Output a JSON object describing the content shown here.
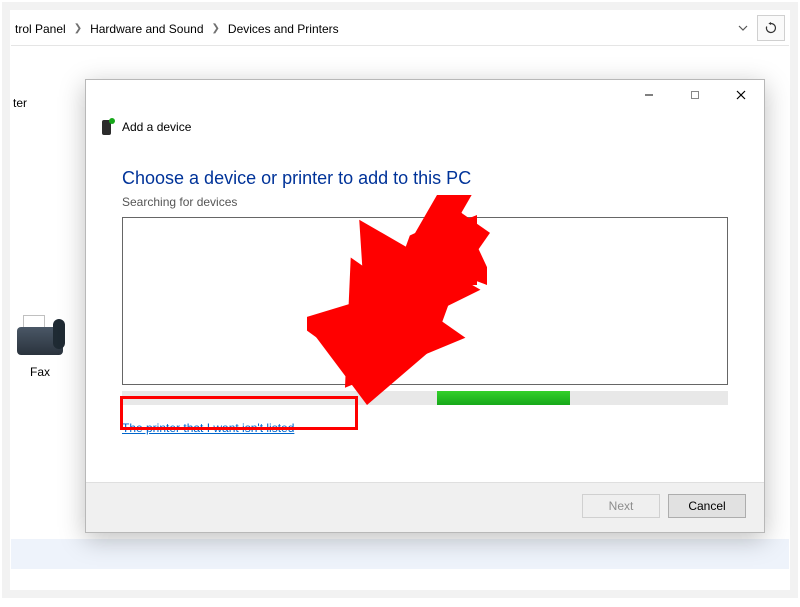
{
  "breadcrumb": {
    "item0": "trol Panel",
    "item1": "Hardware and Sound",
    "item2": "Devices and Printers"
  },
  "sidebar": {
    "label_fragment": "ter"
  },
  "fax": {
    "label": "Fax"
  },
  "dialog": {
    "title": "Add a device",
    "headline": "Choose a device or printer to add to this PC",
    "status": "Searching for devices",
    "link_not_listed": "The printer that I want isn't listed",
    "next_label": "Next",
    "cancel_label": "Cancel"
  }
}
